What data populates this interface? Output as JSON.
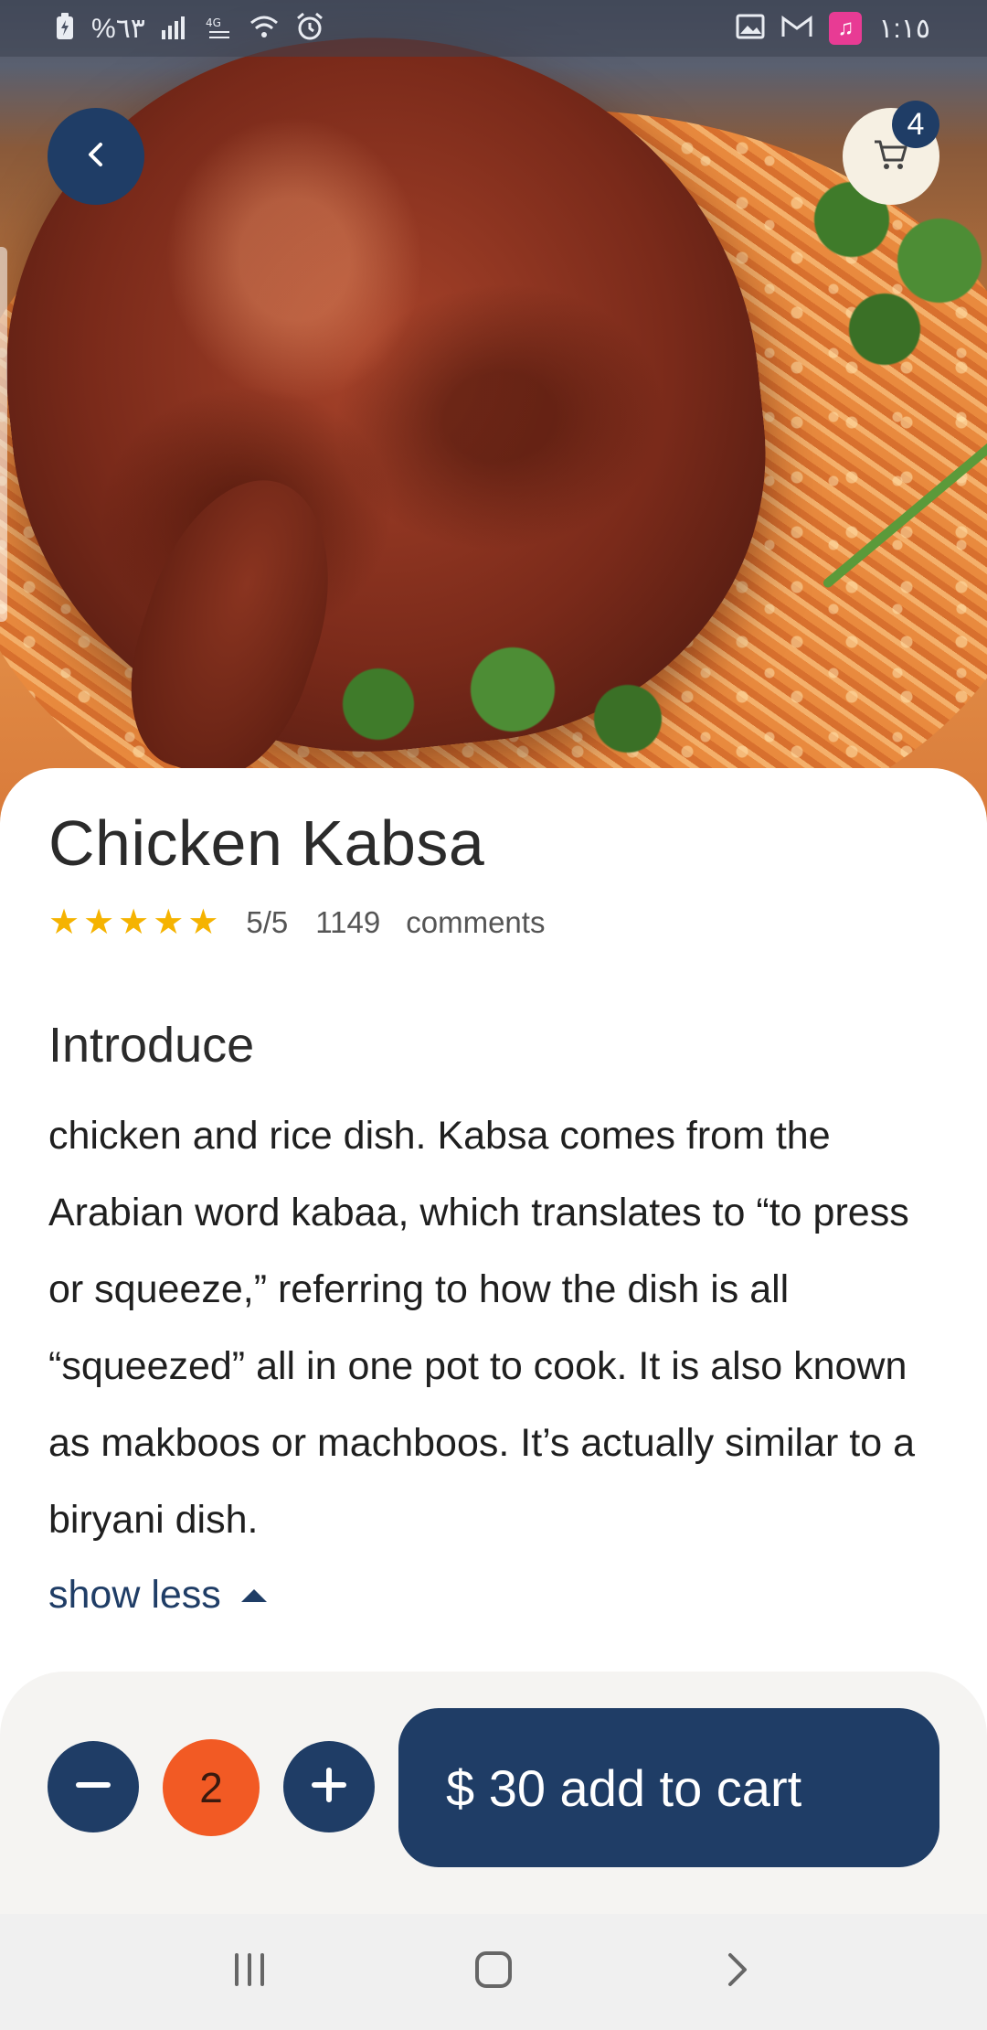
{
  "status_bar": {
    "battery": "%٦٣",
    "time": "١:١٥"
  },
  "header": {
    "cart_count": "4"
  },
  "product": {
    "name": "Chicken Kabsa",
    "rating": "5/5",
    "comments_count": "1149",
    "comments_label": "comments",
    "stars_filled": 5
  },
  "intro": {
    "title": "Introduce",
    "text": "chicken and rice dish. Kabsa comes from the Arabian word kabaa, which translates to “to press or squeeze,” referring to how the dish is all “squeezed” all in one pot to cook. It is also known as makboos or machboos. It’s actually similar to a biryani dish.",
    "toggle_label": "show less"
  },
  "cart_bar": {
    "quantity": "2",
    "add_label": "$ 30 add to cart"
  },
  "icons": {
    "back": "chevron-left-icon",
    "cart": "shopping-cart-icon",
    "minus": "minus-icon",
    "plus": "plus-icon",
    "star": "star-icon",
    "recents": "recents-icon",
    "home": "home-icon",
    "forward": "chevron-right-icon"
  },
  "colors": {
    "primary": "#1f3d66",
    "accent": "#f25a24",
    "star": "#f5b301",
    "cart_bg": "#f6f0e3"
  }
}
